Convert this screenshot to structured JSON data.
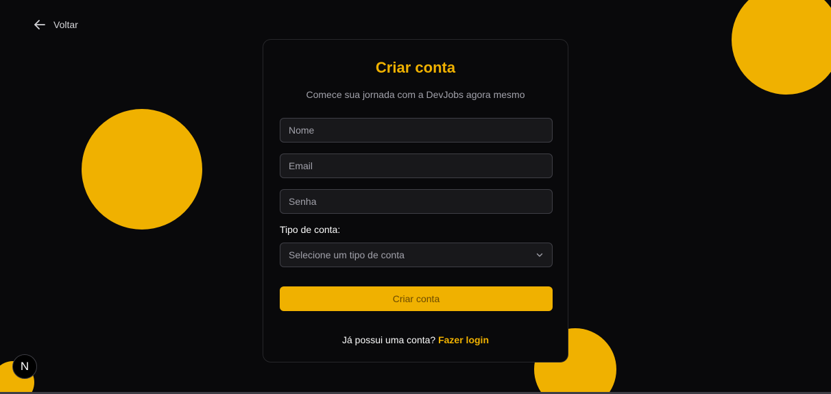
{
  "nav": {
    "back_label": "Voltar"
  },
  "card": {
    "title": "Criar conta",
    "subtitle": "Comece sua jornada com a DevJobs agora mesmo"
  },
  "form": {
    "name_placeholder": "Nome",
    "email_placeholder": "Email",
    "password_placeholder": "Senha",
    "account_type_label": "Tipo de conta:",
    "account_type_placeholder": "Selecione um tipo de conta",
    "submit_label": "Criar conta"
  },
  "footer": {
    "question": "Já possui uma conta?",
    "login_link": "Fazer login"
  },
  "badge": {
    "letter": "N"
  },
  "colors": {
    "background": "#09090b",
    "accent": "#f0b100",
    "card_border": "#27272a",
    "input_background": "#18181b"
  },
  "icons": {
    "back": "arrow-left-icon",
    "select": "chevron-down-icon"
  }
}
